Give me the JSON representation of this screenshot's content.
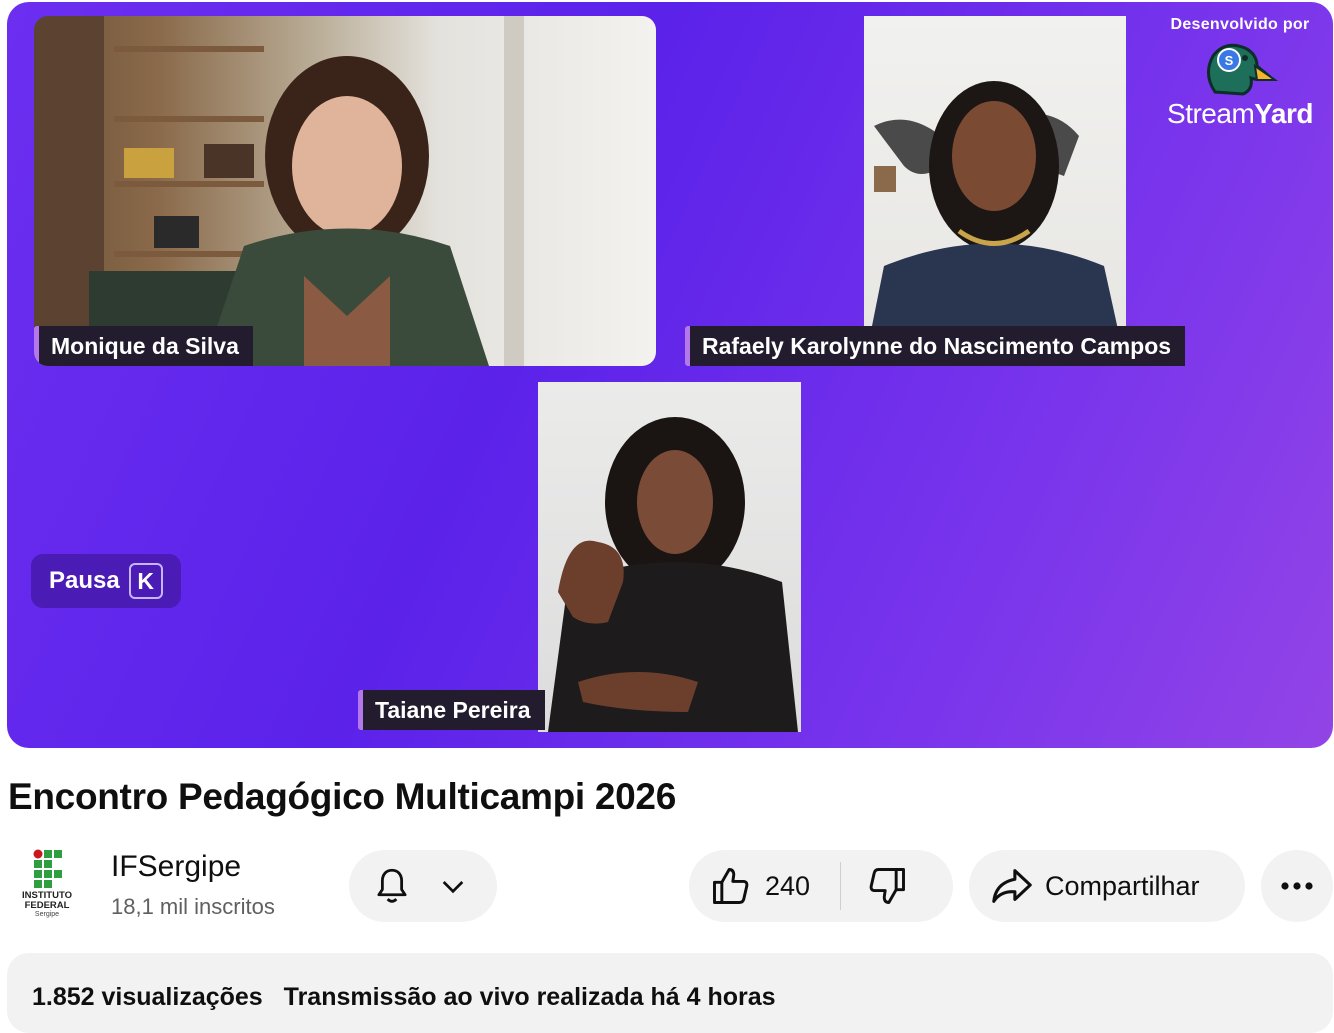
{
  "player": {
    "participants": [
      {
        "name": "Monique da Silva"
      },
      {
        "name": "Rafaely Karolynne do Nascimento Campos"
      },
      {
        "name": "Taiane Pereira"
      }
    ],
    "pause_label": "Pausa",
    "pause_shortcut": "K",
    "streamyard": {
      "developed_by": "Desenvolvido por",
      "brand_regular": "Stream",
      "brand_bold": "Yard"
    }
  },
  "video": {
    "title": "Encontro Pedagógico Multicampi 2026"
  },
  "channel": {
    "name": "IFSergipe",
    "subscribers": "18,1 mil inscritos",
    "logo_text": [
      "INSTITUTO",
      "FEDERAL",
      "Sergipe"
    ]
  },
  "actions": {
    "likes": "240",
    "share_label": "Compartilhar"
  },
  "description": {
    "views": "1.852 visualizações",
    "date": "Transmissão ao vivo realizada há 4 horas"
  },
  "icons": [
    "bell-icon",
    "chevron-down-icon",
    "thumbs-up-icon",
    "thumbs-down-icon",
    "share-icon",
    "more-icon",
    "streamyard-duck-icon"
  ],
  "colors": {
    "player_bg": "#6c2ff0",
    "nametag_bg": "#231b2e",
    "nametag_accent": "#b577ec",
    "pill_bg": "#f2f2f2",
    "logo_green": "#2f9e41",
    "logo_red": "#c8191e"
  }
}
